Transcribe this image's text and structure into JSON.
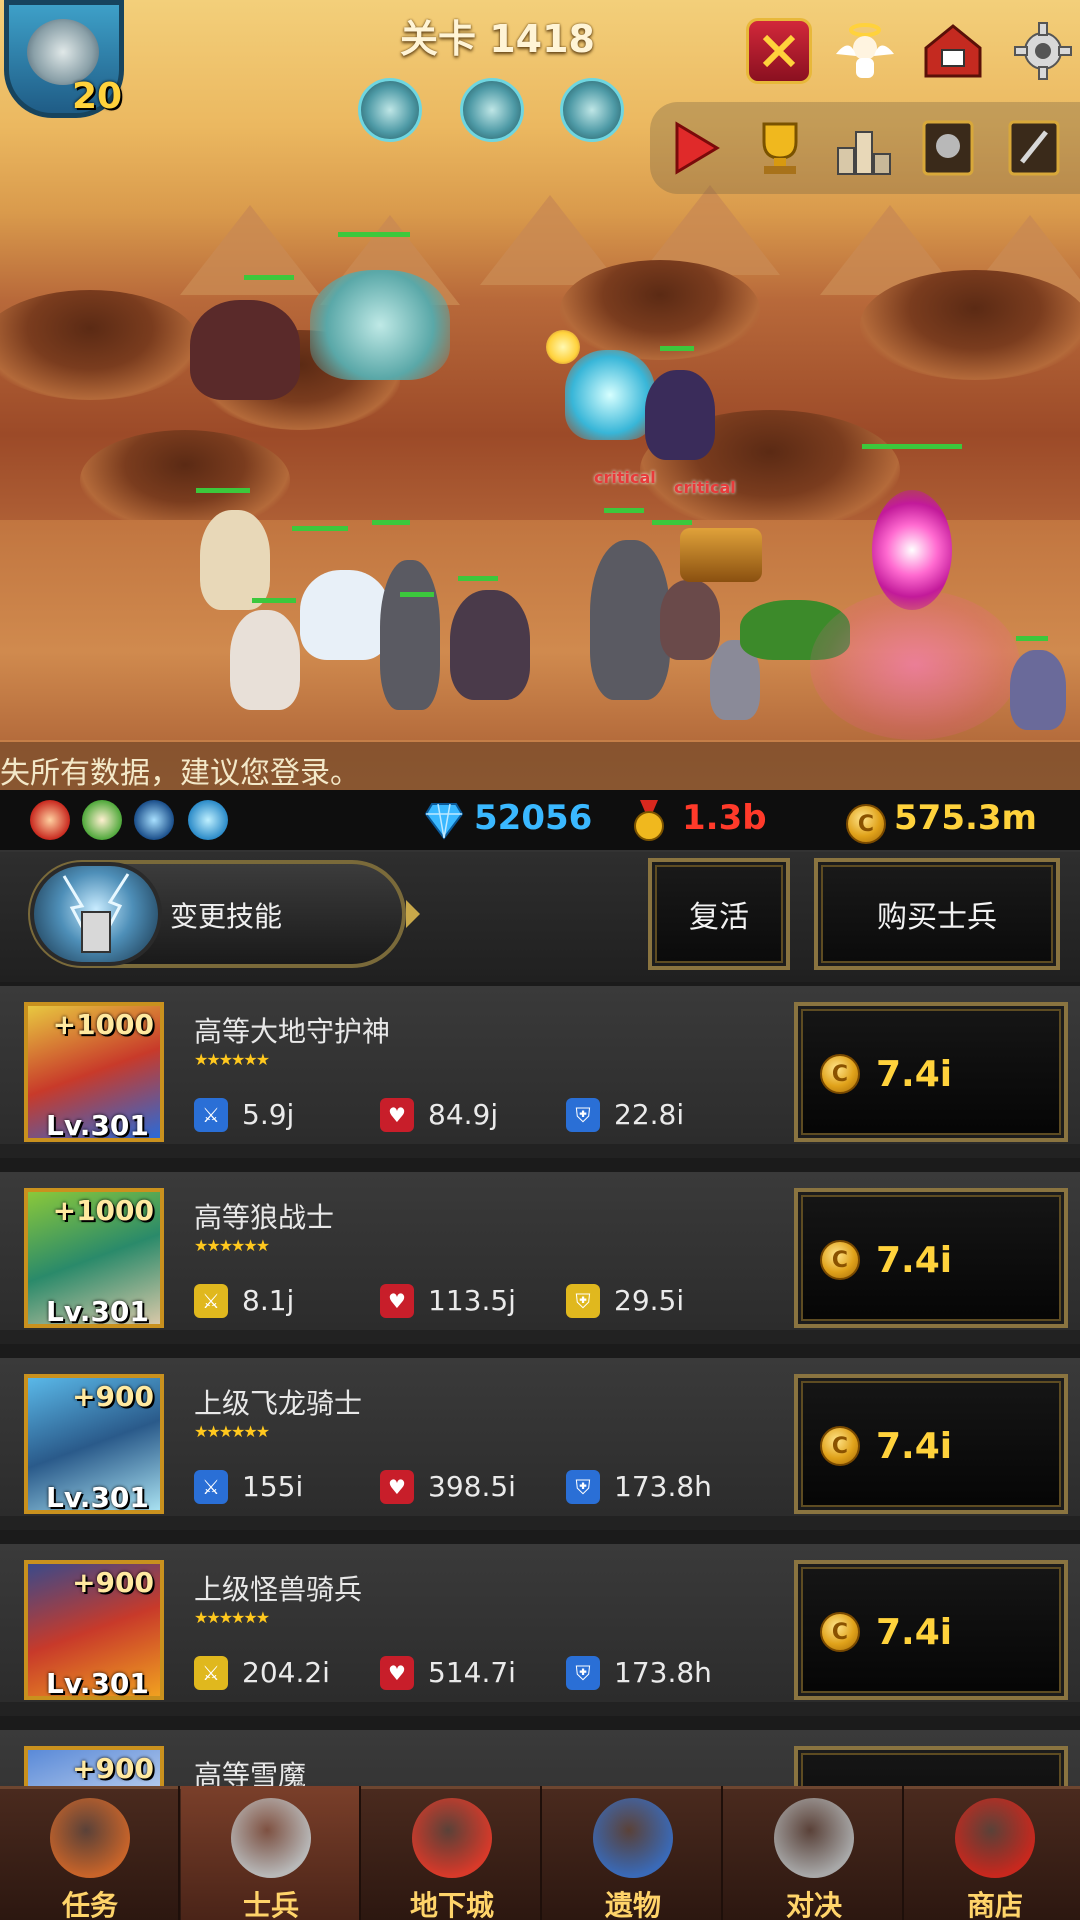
{
  "header": {
    "stage": "关卡 1418",
    "player_level": "20",
    "login_notice": "失所有数据，建议您登录。"
  },
  "top_icons": [
    "guild-shield-icon",
    "angel-icon",
    "mailbox-icon",
    "gear-icon"
  ],
  "tools": [
    "play-icon",
    "trophy-icon",
    "ranking-icon",
    "helmet-book-icon",
    "sword-book-icon"
  ],
  "battle": {
    "critical_1": "critical",
    "critical_2": "critical"
  },
  "resources": {
    "gems": "52056",
    "medals": "1.3b",
    "gold": "575.3m"
  },
  "actions": {
    "change_skill": "变更技能",
    "revive": "复活",
    "buy_soldier": "购买士兵"
  },
  "soldiers": [
    {
      "plus": "+1000",
      "level": "Lv.301",
      "name": "高等大地守护神",
      "stars": "★★★★★★",
      "atk": "5.9j",
      "hp": "84.9j",
      "def": "22.8i",
      "cost": "7.4i",
      "atk_color": "#2a6fd6",
      "def_color": "#2a6fd6"
    },
    {
      "plus": "+1000",
      "level": "Lv.301",
      "name": "高等狼战士",
      "stars": "★★★★★★",
      "atk": "8.1j",
      "hp": "113.5j",
      "def": "29.5i",
      "cost": "7.4i",
      "atk_color": "#e0b81e",
      "def_color": "#e0b81e"
    },
    {
      "plus": "+900",
      "level": "Lv.301",
      "name": "上级飞龙骑士",
      "stars": "★★★★★★",
      "atk": "155i",
      "hp": "398.5i",
      "def": "173.8h",
      "cost": "7.4i",
      "atk_color": "#2a6fd6",
      "def_color": "#2a6fd6"
    },
    {
      "plus": "+900",
      "level": "Lv.301",
      "name": "上级怪兽骑兵",
      "stars": "★★★★★★",
      "atk": "204.2i",
      "hp": "514.7i",
      "def": "173.8h",
      "cost": "7.4i",
      "atk_color": "#e0b81e",
      "def_color": "#2a6fd6"
    },
    {
      "plus": "+900",
      "level": "",
      "name": "高等雪魔",
      "stars": "",
      "atk": "",
      "hp": "",
      "def": "",
      "cost": "",
      "atk_color": "#2a6fd6",
      "def_color": "#2a6fd6"
    }
  ],
  "nav": [
    {
      "label": "任务",
      "icon": "scroll-icon"
    },
    {
      "label": "士兵",
      "icon": "soldier-helmet-icon"
    },
    {
      "label": "地下城",
      "icon": "dungeon-flower-icon"
    },
    {
      "label": "遗物",
      "icon": "orb-icon"
    },
    {
      "label": "对决",
      "icon": "crossed-swords-icon"
    },
    {
      "label": "商店",
      "icon": "shop-icon"
    }
  ]
}
